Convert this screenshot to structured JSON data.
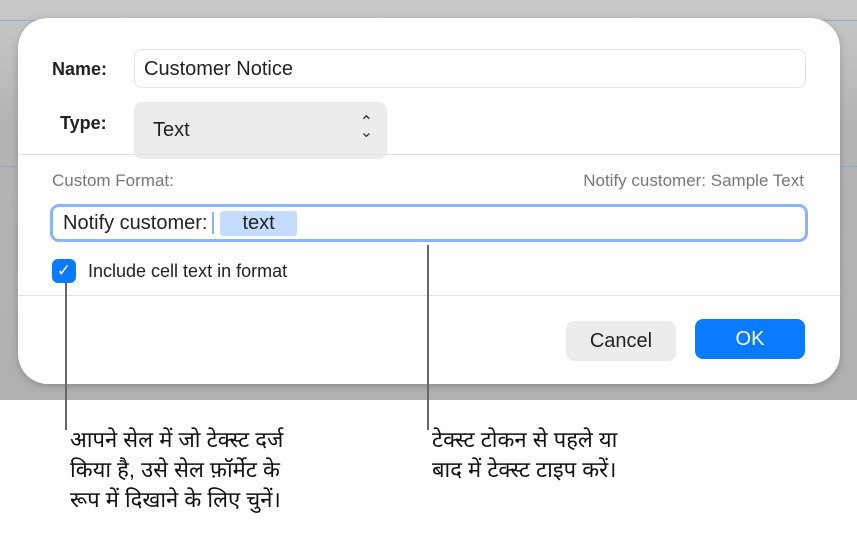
{
  "dialog": {
    "name_label": "Name:",
    "name_value": "Customer Notice",
    "type_label": "Type:",
    "type_value": "Text",
    "custom_format_label": "Custom Format:",
    "preview": "Notify customer: Sample Text",
    "format_prefix": "Notify customer:",
    "token": "text",
    "include_checkbox_label": "Include cell text in format",
    "include_checked": true,
    "cancel_label": "Cancel",
    "ok_label": "OK"
  },
  "callouts": {
    "left": [
      "आपने सेल में जो टेक्स्ट दर्ज",
      "किया है, उसे सेल फ़ॉर्मेट के",
      "रूप में दिखाने के लिए चुनें।"
    ],
    "right": [
      "टेक्स्ट टोकन से पहले या",
      "बाद में टेक्स्ट टाइप करें।"
    ]
  },
  "colors": {
    "accent": "#0a7aff",
    "token_bg": "#c4dcff",
    "focus_ring": "#8db4f5"
  }
}
